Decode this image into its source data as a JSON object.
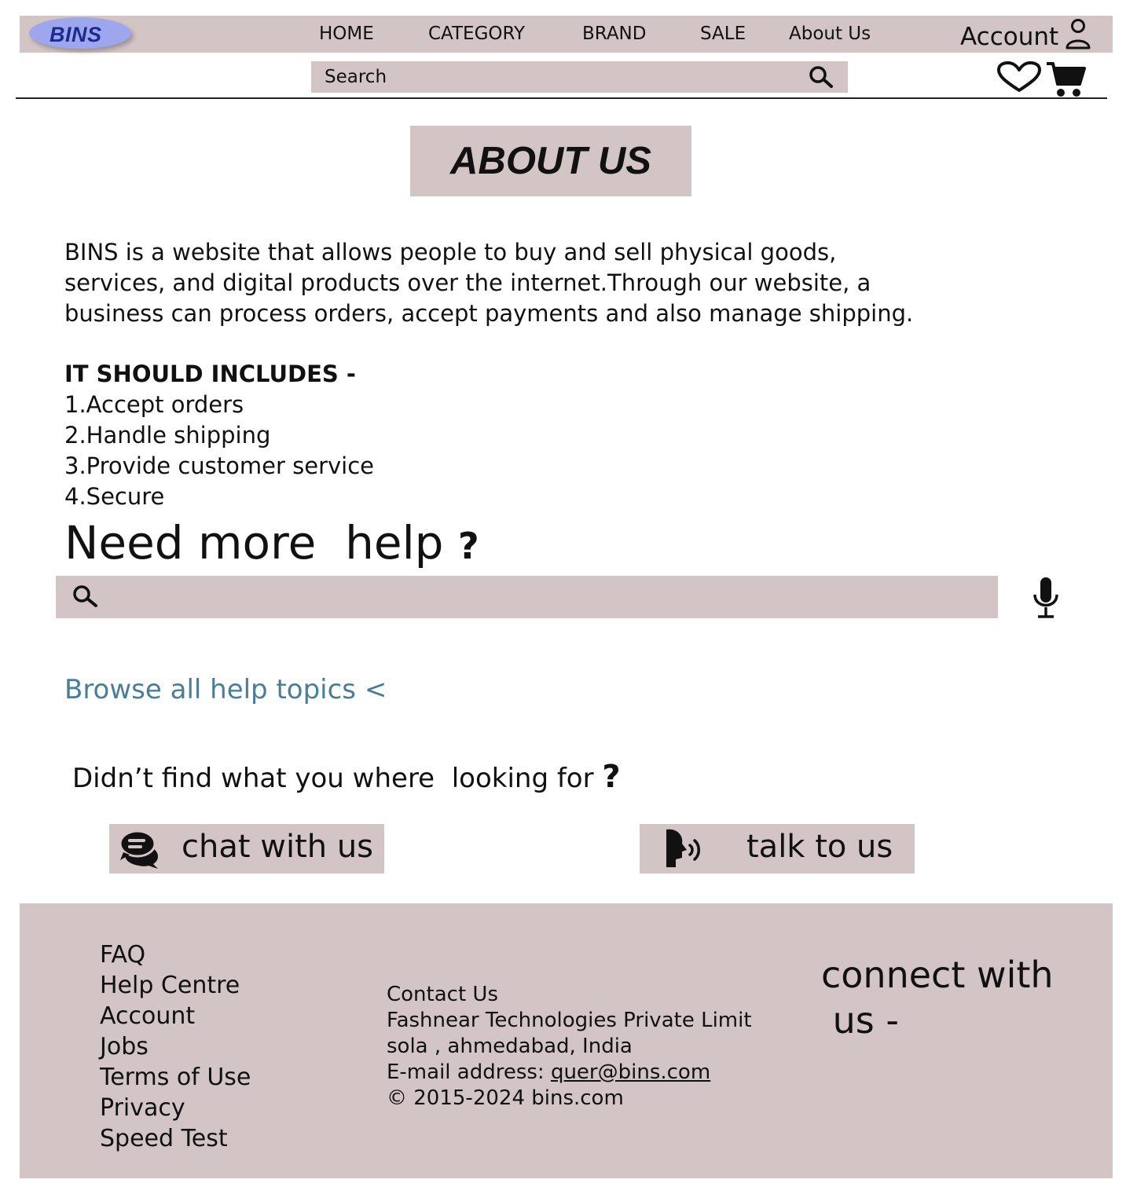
{
  "header": {
    "logo_text": "BINS",
    "nav": [
      "HOME",
      "CATEGORY",
      "BRAND",
      "SALE",
      "About Us"
    ],
    "account_label": "Account",
    "search_placeholder": "Search"
  },
  "about": {
    "title": "ABOUT US",
    "description": "BINS is a website that allows people to buy and sell physical goods, services, and digital products over the internet.Through our website, a business can process orders, accept payments and also  manage shipping.",
    "includes_heading": "IT SHOULD INCLUDES -",
    "includes": [
      "1.Accept orders",
      "2.Handle shipping",
      "3.Provide customer service",
      "4.Secure"
    ]
  },
  "help": {
    "heading": "Need more  help",
    "heading_mark": "?",
    "browse_link": "Browse all help topics <",
    "not_found_text": "Didn’t find what you where  looking for ",
    "not_found_mark": "?",
    "chat_label": "chat with us",
    "talk_label": "talk to us"
  },
  "footer": {
    "links": [
      "FAQ",
      "Help Centre",
      "Account",
      "Jobs",
      "Terms of Use",
      "Privacy",
      "Speed Test"
    ],
    "contact_heading": "Contact Us",
    "company": "Fashnear Technologies Private Limit",
    "address": "sola , ahmedabad, India",
    "email_label": "E-mail address: ",
    "email": "quer@bins.com",
    "copyright": "© 2015-2024 bins.com",
    "connect": "connect with\n us -"
  },
  "colors": {
    "panel": "#d3c5c5",
    "logo_bg": "#9ea6ee",
    "logo_text": "#1e2a8c",
    "link": "#4a7d96"
  }
}
